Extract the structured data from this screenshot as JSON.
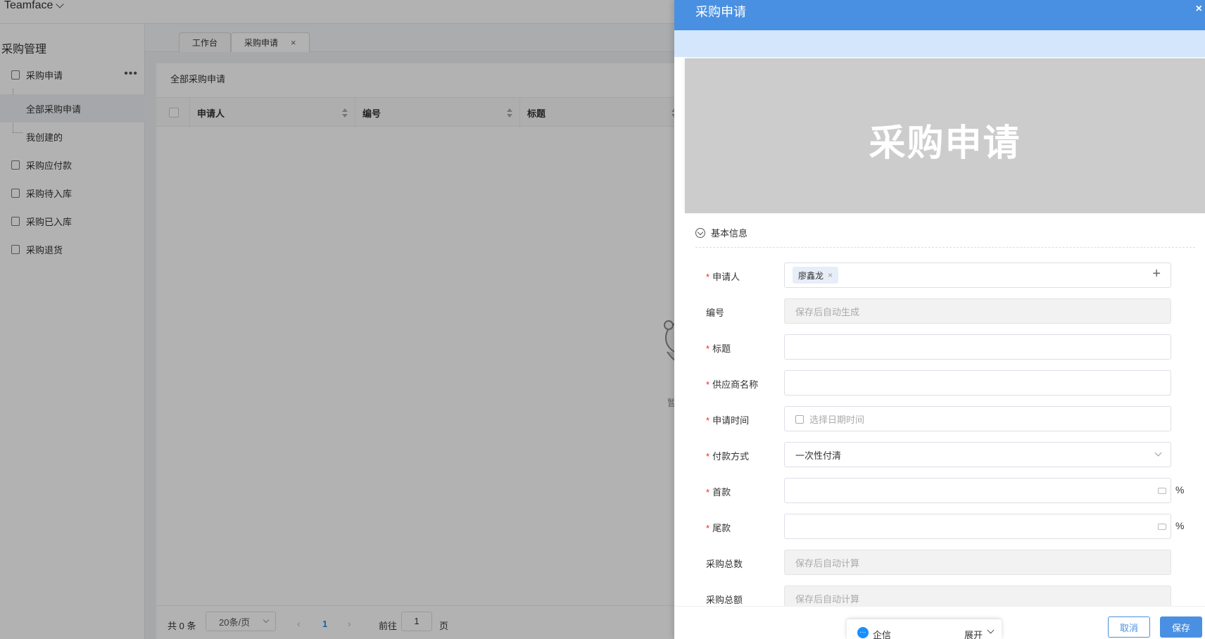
{
  "app": {
    "brand": "Teamface"
  },
  "sidebar": {
    "title": "采购管理",
    "items": [
      {
        "label": "采购申请",
        "icon": "purchase-request-icon"
      },
      {
        "label": "全部采购申请"
      },
      {
        "label": "我创建的"
      },
      {
        "label": "采购应付款",
        "icon": "payable-icon"
      },
      {
        "label": "采购待入库",
        "icon": "pending-stock-icon"
      },
      {
        "label": "采购已入库",
        "icon": "stocked-icon"
      },
      {
        "label": "采购退货",
        "icon": "return-icon"
      }
    ],
    "more": "•••"
  },
  "tabs": [
    {
      "label": "工作台"
    },
    {
      "label": "采购申请",
      "close": "×"
    }
  ],
  "list": {
    "title": "全部采购申请",
    "columns": [
      "申请人",
      "编号",
      "标题"
    ],
    "empty_text": "暂"
  },
  "pager": {
    "total": "共 0 条",
    "page_size": "20条/页",
    "prev": "‹",
    "current": "1",
    "next": "›",
    "goto": "前往",
    "goto_value": "1",
    "page_suffix": "页"
  },
  "drawer": {
    "title": "采购申请",
    "close": "×",
    "banner": "采购申请",
    "section": "基本信息",
    "fields": [
      {
        "label": "申请人",
        "required": true,
        "tag": "廖鑫龙",
        "tag_close": "×",
        "add": "+"
      },
      {
        "label": "编号",
        "required": false,
        "placeholder": "保存后自动生成"
      },
      {
        "label": "标题",
        "required": true,
        "value": ""
      },
      {
        "label": "供应商名称",
        "required": true,
        "value": ""
      },
      {
        "label": "申请时间",
        "required": true,
        "placeholder": "选择日期时间"
      },
      {
        "label": "付款方式",
        "required": true,
        "value": "一次性付清"
      },
      {
        "label": "首款",
        "required": true,
        "value": "",
        "suffix": "%"
      },
      {
        "label": "尾款",
        "required": true,
        "value": "",
        "suffix": "%"
      },
      {
        "label": "采购总数",
        "required": false,
        "placeholder": "保存后自动计算"
      },
      {
        "label": "采购总额",
        "required": false,
        "placeholder": "保存后自动计算"
      }
    ],
    "required_mark": "*",
    "cancel": "取消",
    "save": "保存"
  },
  "chat": {
    "icon": "…",
    "label": "企信",
    "expand": "展开"
  },
  "colors": {
    "primary": "#4a90e2",
    "required": "#f5222d",
    "banner_bg": "#cccccc",
    "strip_bg": "#d4e6fb"
  }
}
